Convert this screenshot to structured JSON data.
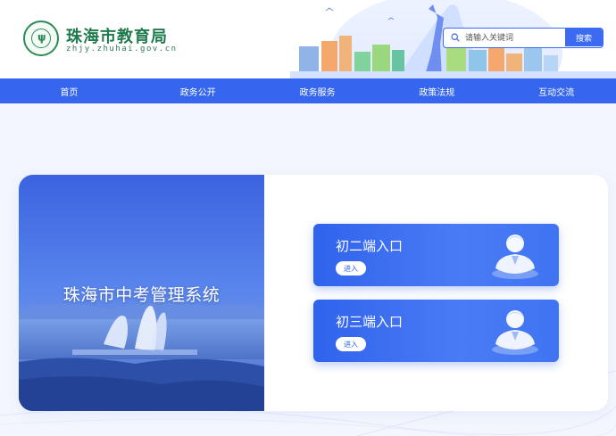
{
  "header": {
    "logo_title": "珠海市教育局",
    "logo_domain": "zhjy.zhuhai.gov.cn",
    "logo_emblem": "education-bureau-emblem"
  },
  "search": {
    "placeholder": "请输入关键词",
    "button_label": "搜索",
    "icon": "search-icon"
  },
  "nav": {
    "items": [
      {
        "label": "首页"
      },
      {
        "label": "政务公开"
      },
      {
        "label": "政务服务"
      },
      {
        "label": "政策法规"
      },
      {
        "label": "互动交流"
      }
    ]
  },
  "main": {
    "system_title": "珠海市中考管理系统",
    "entries": [
      {
        "title": "初二端入口",
        "button_label": "进入",
        "icon": "user-figure-icon"
      },
      {
        "title": "初三端入口",
        "button_label": "进入",
        "icon": "user-figure-icon"
      }
    ]
  },
  "colors": {
    "primary": "#3666ee",
    "logo_green": "#1f7a4d",
    "background": "#f3f6fd"
  }
}
